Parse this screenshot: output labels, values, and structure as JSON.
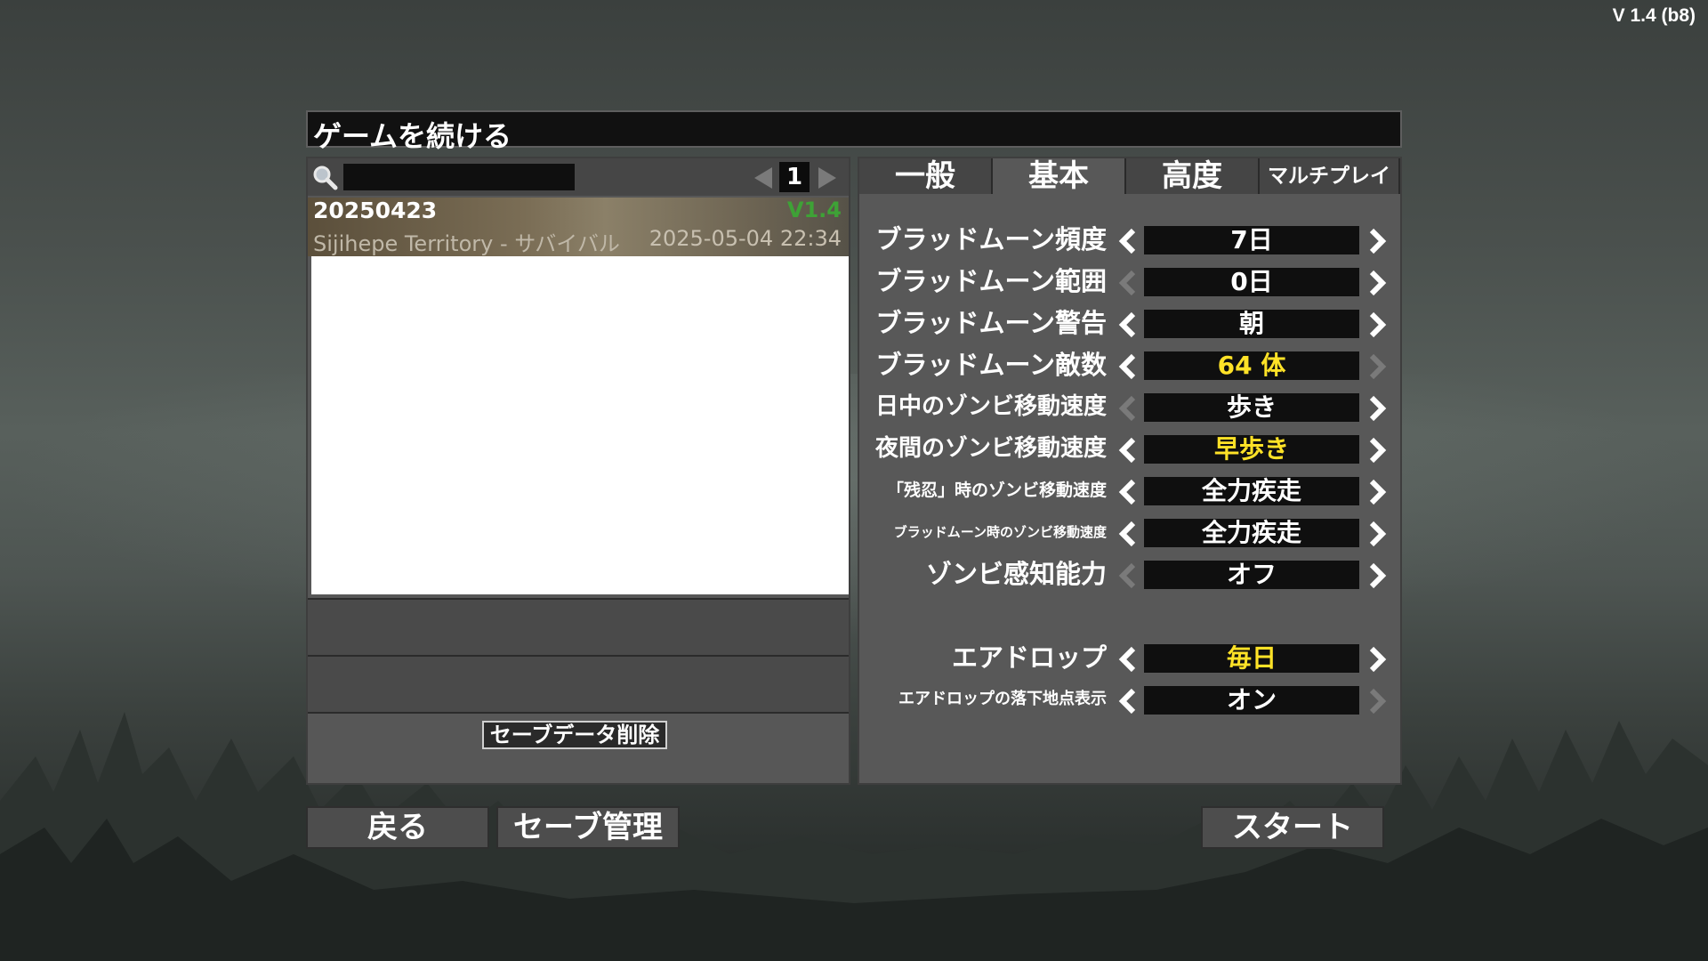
{
  "version": "V 1.4 (b8)",
  "title": "ゲームを続ける",
  "search": {
    "value": "",
    "placeholder": ""
  },
  "pager": {
    "page": "1"
  },
  "save_entry": {
    "name": "20250423",
    "version": "V1.4",
    "world": "Sijihepe Territory - サバイバル",
    "date": "2025-05-04 22:34"
  },
  "delete_label": "セーブデータ削除",
  "tabs": [
    "一般",
    "基本",
    "高度",
    "マルチプレイ"
  ],
  "active_tab": "基本",
  "settings": [
    {
      "label": "ブラッドムーン頻度",
      "value": "7日",
      "highlight": false,
      "left_enabled": true,
      "right_enabled": true
    },
    {
      "label": "ブラッドムーン範囲",
      "value": "0日",
      "highlight": false,
      "left_enabled": false,
      "right_enabled": true
    },
    {
      "label": "ブラッドムーン警告",
      "value": "朝",
      "highlight": false,
      "left_enabled": true,
      "right_enabled": true
    },
    {
      "label": "ブラッドムーン敵数",
      "value": "64 体",
      "highlight": true,
      "left_enabled": true,
      "right_enabled": false
    },
    {
      "label": "日中のゾンビ移動速度",
      "value": "歩き",
      "highlight": false,
      "left_enabled": false,
      "right_enabled": true
    },
    {
      "label": "夜間のゾンビ移動速度",
      "value": "早歩き",
      "highlight": true,
      "left_enabled": true,
      "right_enabled": true
    },
    {
      "label": "「残忍」時のゾンビ移動速度",
      "value": "全力疾走",
      "highlight": false,
      "left_enabled": true,
      "right_enabled": true
    },
    {
      "label": "ブラッドムーン時のゾンビ移動速度",
      "value": "全力疾走",
      "highlight": false,
      "left_enabled": true,
      "right_enabled": true
    },
    {
      "label": "ゾンビ感知能力",
      "value": "オフ",
      "highlight": false,
      "left_enabled": false,
      "right_enabled": true
    },
    {
      "label": "エアドロップ",
      "value": "毎日",
      "highlight": true,
      "left_enabled": true,
      "right_enabled": true
    },
    {
      "label": "エアドロップの落下地点表示",
      "value": "オン",
      "highlight": false,
      "left_enabled": true,
      "right_enabled": false
    }
  ],
  "buttons": {
    "back": "戻る",
    "save_manage": "セーブ管理",
    "start": "スタート"
  },
  "colors": {
    "highlight": "#ffe227",
    "version_green": "#3ea236",
    "arrow_enabled": "#ffffff",
    "arrow_disabled": "#7a7a7a"
  }
}
